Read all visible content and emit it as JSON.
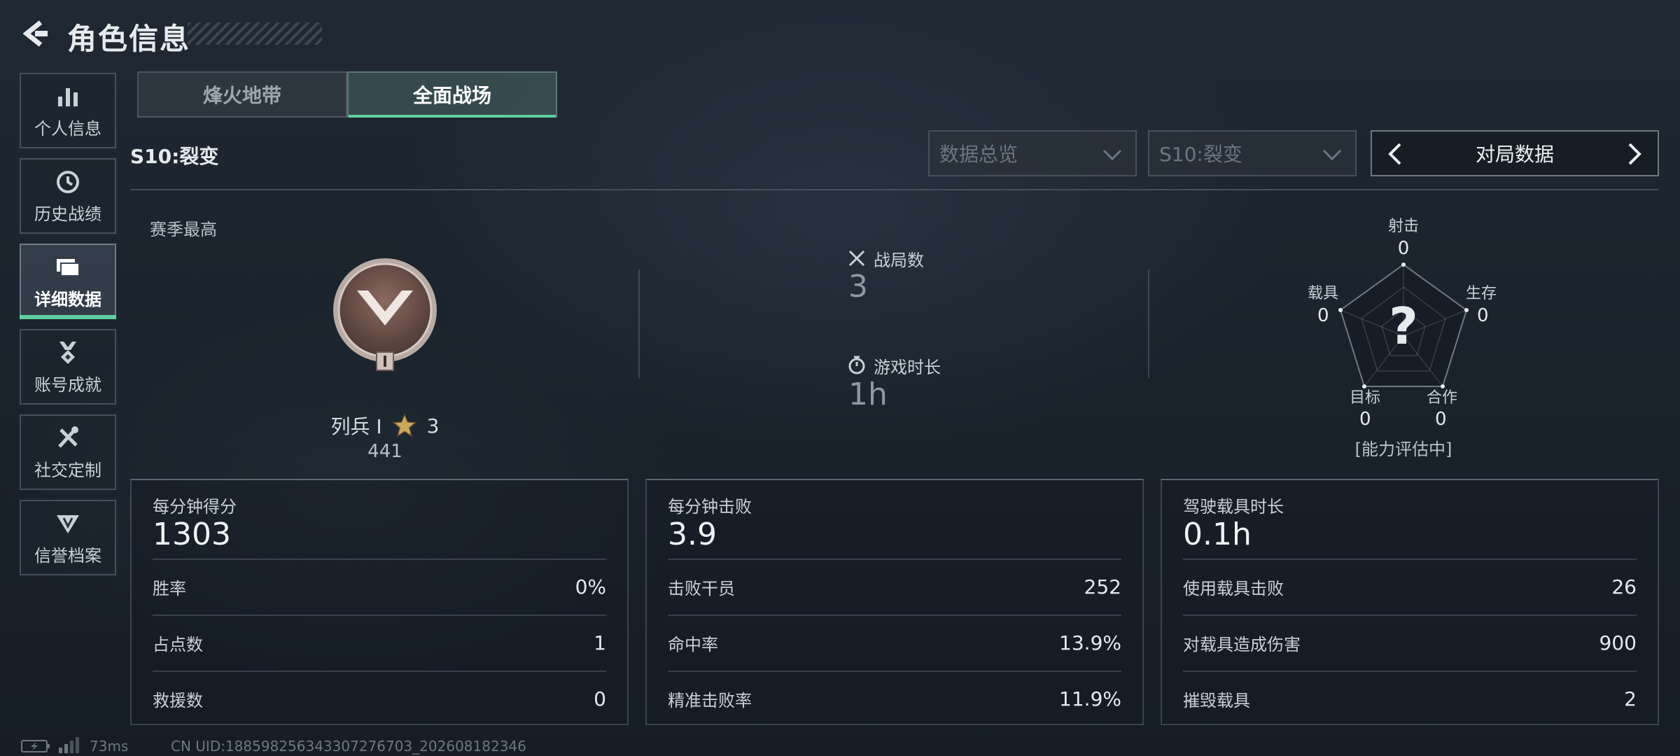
{
  "header": {
    "title": "角色信息"
  },
  "sidebar": {
    "items": [
      {
        "label": "个人信息",
        "icon": "bar-chart-icon"
      },
      {
        "label": "历史战绩",
        "icon": "history-clock-icon"
      },
      {
        "label": "详细数据",
        "icon": "folders-icon",
        "active": true
      },
      {
        "label": "账号成就",
        "icon": "medal-icon"
      },
      {
        "label": "社交定制",
        "icon": "tools-icon"
      },
      {
        "label": "信誉档案",
        "icon": "shield-emblem-icon"
      }
    ]
  },
  "tabs": [
    {
      "label": "烽火地带"
    },
    {
      "label": "全面战场",
      "active": true
    }
  ],
  "season_label": "S10:裂变",
  "filters": {
    "dropdown1": "数据总览",
    "dropdown2": "S10:裂变",
    "switcher": "对局数据"
  },
  "overview": {
    "season_best_label": "赛季最高",
    "rank_name": "列兵 Ⅰ",
    "rank_stars": "3",
    "rank_score": "441",
    "battles_label": "战局数",
    "battles_value": "3",
    "playtime_label": "游戏时长",
    "playtime_value": "1h"
  },
  "radar": {
    "axes": [
      {
        "label": "射击",
        "value": "0"
      },
      {
        "label": "生存",
        "value": "0"
      },
      {
        "label": "合作",
        "value": "0"
      },
      {
        "label": "目标",
        "value": "0"
      },
      {
        "label": "载具",
        "value": "0"
      }
    ],
    "center_mark": "?",
    "status": "[能力评估中]"
  },
  "cards": [
    {
      "title": "每分钟得分",
      "big": "1303",
      "rows": [
        {
          "label": "胜率",
          "value": "0%"
        },
        {
          "label": "占点数",
          "value": "1"
        },
        {
          "label": "救援数",
          "value": "0"
        }
      ]
    },
    {
      "title": "每分钟击败",
      "big": "3.9",
      "rows": [
        {
          "label": "击败干员",
          "value": "252"
        },
        {
          "label": "命中率",
          "value": "13.9%"
        },
        {
          "label": "精准击败率",
          "value": "11.9%"
        }
      ]
    },
    {
      "title": "驾驶载具时长",
      "big": "0.1h",
      "rows": [
        {
          "label": "使用载具击败",
          "value": "26"
        },
        {
          "label": "对载具造成伤害",
          "value": "900"
        },
        {
          "label": "摧毁载具",
          "value": "2"
        }
      ]
    }
  ],
  "footer": {
    "ping": "73ms",
    "uid": "CN UID:18859825634330727​6703_202608182346"
  },
  "colors": {
    "accent": "#5fcf9f",
    "background": "#1c242e"
  }
}
